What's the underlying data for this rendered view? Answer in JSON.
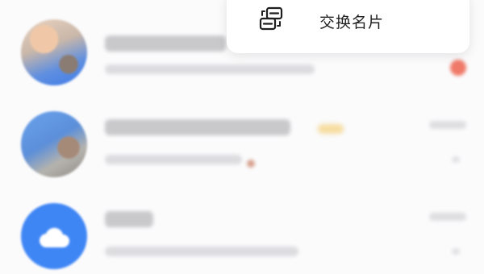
{
  "popup_menu": {
    "items": [
      {
        "label": "交换名片",
        "icon": "exchange-card-icon"
      }
    ]
  },
  "chat_list": {
    "rows": [
      {
        "avatar": "user-photo-avatar",
        "has_unread_badge": true
      },
      {
        "avatar": "group-photo-avatar",
        "has_unread_badge": false
      },
      {
        "avatar": "cloud-icon",
        "has_unread_badge": false
      }
    ]
  },
  "colors": {
    "background": "#fbfbfc",
    "unread_badge": "#ef7a6a",
    "cloud_avatar": "#3f86f5",
    "menu_text": "#1f1f1f"
  }
}
